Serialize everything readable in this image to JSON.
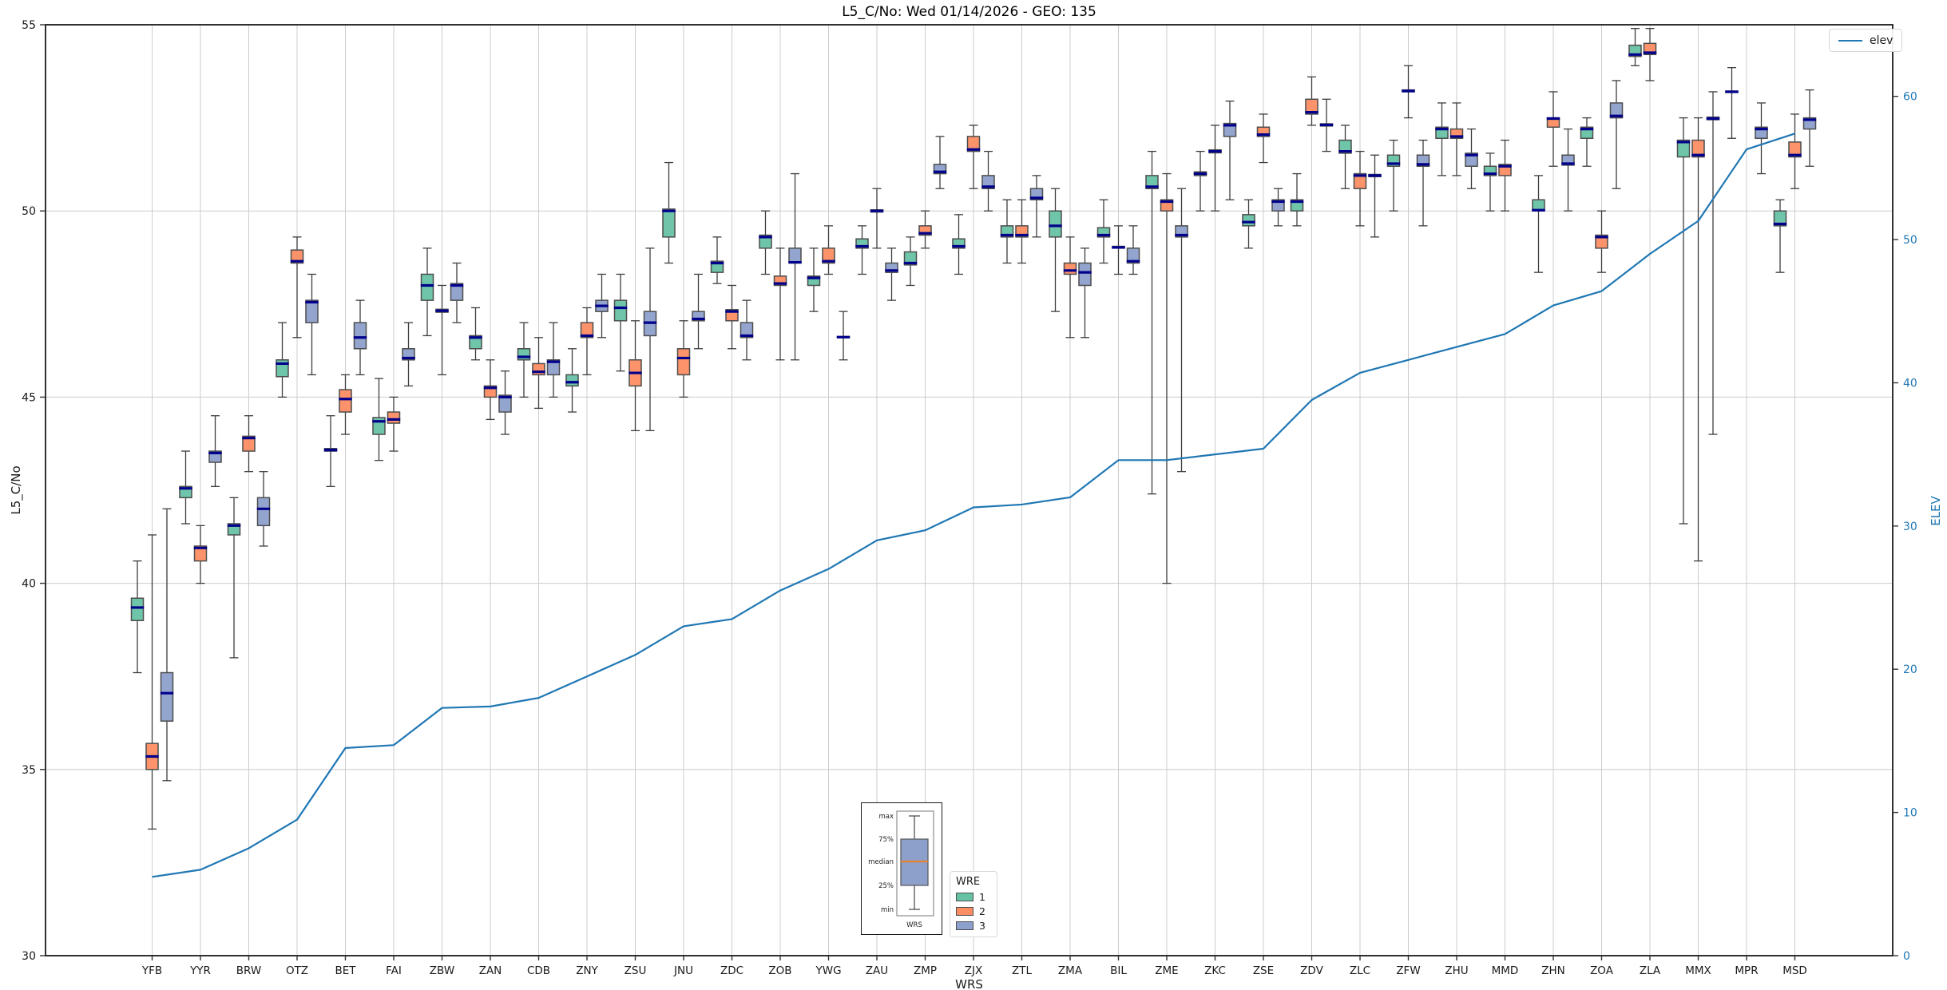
{
  "title": "L5_C/No: Wed 01/14/2026 - GEO: 135",
  "axes": {
    "left": {
      "label": "L5_C/No",
      "ticks": [
        55,
        50,
        45,
        40,
        35,
        30
      ],
      "range": [
        30,
        55
      ]
    },
    "right": {
      "label": "ELEV",
      "ticks": [
        60,
        50,
        40,
        30,
        20,
        10,
        0
      ],
      "range": [
        0,
        65
      ],
      "color": "#1f77b4"
    },
    "x": {
      "label": "WRS"
    }
  },
  "legend_elev": {
    "label": "elev"
  },
  "legend_wre": {
    "title": "WRE",
    "entries": [
      {
        "label": "1",
        "color": "#66c2a5"
      },
      {
        "label": "2",
        "color": "#fc8d62"
      },
      {
        "label": "3",
        "color": "#8da0cb"
      }
    ]
  },
  "inset": {
    "labels": [
      "max",
      "75%",
      "median",
      "25%",
      "min"
    ],
    "xlabel": "WRS",
    "box_color": "#8da0cb",
    "median_color": "#e8822d"
  },
  "style": {
    "grid_color": "#cccccc",
    "spine_color": "#1a1a1a",
    "box_edge_color": "#4d4d4d",
    "median_color": "#00008b",
    "whisker_color": "#3d3d3d",
    "line_color": "#1f77b4"
  },
  "chart_data": {
    "type": "boxplot+line",
    "title": "L5_C/No: Wed 01/14/2026 - GEO: 135",
    "xlabel": "WRS",
    "ylabel_left": "L5_C/No",
    "ylabel_right": "ELEV",
    "ylim_left": [
      30,
      55
    ],
    "ylim_right": [
      0,
      65
    ],
    "grid": true,
    "legend_position": "upper right",
    "categories": [
      "YFB",
      "YYR",
      "BRW",
      "OTZ",
      "BET",
      "FAI",
      "ZBW",
      "ZAN",
      "CDB",
      "ZNY",
      "ZSU",
      "JNU",
      "ZDC",
      "ZOB",
      "YWG",
      "ZAU",
      "ZMP",
      "ZJX",
      "ZTL",
      "ZMA",
      "BIL",
      "ZME",
      "ZKC",
      "ZSE",
      "ZDV",
      "ZLC",
      "ZFW",
      "ZHU",
      "MMD",
      "ZHN",
      "ZOA",
      "ZLA",
      "MMX",
      "MPR",
      "MSD"
    ],
    "box_stats_order": [
      "min",
      "q1",
      "median",
      "q3",
      "max"
    ],
    "series": [
      {
        "name": "1",
        "color": "#66c2a5",
        "boxes": [
          [
            37.6,
            39.0,
            39.35,
            39.6,
            40.6
          ],
          [
            41.6,
            42.3,
            42.55,
            42.6,
            43.55
          ],
          [
            38.0,
            41.3,
            41.55,
            41.6,
            42.3
          ],
          [
            45.0,
            45.55,
            45.9,
            46.0,
            47.0
          ],
          [
            42.6,
            43.55,
            43.58,
            43.62,
            44.5
          ],
          [
            43.3,
            44.0,
            44.35,
            44.45,
            45.5
          ],
          [
            46.65,
            47.6,
            48.0,
            48.3,
            49.0
          ],
          [
            46.0,
            46.3,
            46.6,
            46.65,
            47.4
          ],
          [
            45.0,
            46.0,
            46.08,
            46.3,
            47.0
          ],
          [
            44.6,
            45.3,
            45.4,
            45.6,
            46.3
          ],
          [
            45.7,
            47.05,
            47.4,
            47.6,
            48.3
          ],
          [
            48.6,
            49.3,
            50.0,
            50.05,
            51.3
          ],
          [
            48.05,
            48.35,
            48.6,
            48.65,
            49.3
          ],
          [
            48.3,
            49.0,
            49.3,
            49.35,
            50.0
          ],
          [
            47.3,
            48.0,
            48.2,
            48.25,
            49.0
          ],
          [
            48.3,
            49.0,
            49.05,
            49.25,
            49.6
          ],
          [
            48.0,
            48.55,
            48.6,
            48.9,
            49.3
          ],
          [
            48.3,
            49.0,
            49.05,
            49.25,
            49.9
          ],
          [
            48.6,
            49.3,
            49.35,
            49.6,
            50.3
          ],
          [
            47.3,
            49.3,
            49.6,
            50.0,
            50.6
          ],
          [
            48.6,
            49.3,
            49.35,
            49.55,
            50.3
          ],
          [
            42.4,
            50.6,
            50.65,
            50.95,
            51.6
          ],
          [
            50.0,
            50.95,
            51.0,
            51.05,
            51.6
          ],
          [
            49.0,
            49.6,
            49.7,
            49.9,
            50.3
          ],
          [
            49.6,
            50.0,
            50.25,
            50.3,
            51.0
          ],
          [
            50.6,
            51.55,
            51.6,
            51.9,
            52.3
          ],
          [
            50.0,
            51.2,
            51.27,
            51.5,
            51.9
          ],
          [
            50.95,
            51.95,
            52.2,
            52.25,
            52.9
          ],
          [
            50.0,
            50.95,
            51.0,
            51.2,
            51.55
          ],
          [
            48.35,
            50.0,
            50.02,
            50.3,
            50.95
          ],
          [
            51.2,
            51.95,
            52.2,
            52.25,
            52.5
          ],
          [
            53.9,
            54.15,
            54.2,
            54.45,
            54.9
          ],
          [
            41.6,
            51.45,
            51.85,
            51.9,
            52.5
          ],
          [
            51.95,
            53.18,
            53.2,
            53.22,
            53.85
          ],
          [
            48.35,
            49.6,
            49.65,
            50.0,
            50.3
          ]
        ]
      },
      {
        "name": "2",
        "color": "#fc8d62",
        "boxes": [
          [
            33.4,
            35.0,
            35.35,
            35.7,
            41.3
          ],
          [
            40.0,
            40.6,
            40.95,
            41.0,
            41.55
          ],
          [
            43.0,
            43.55,
            43.9,
            43.95,
            44.5
          ],
          [
            46.6,
            48.6,
            48.65,
            48.95,
            49.3
          ],
          [
            44.0,
            44.6,
            44.95,
            45.2,
            45.6
          ],
          [
            43.55,
            44.3,
            44.4,
            44.6,
            45.0
          ],
          [
            45.6,
            47.28,
            47.32,
            47.36,
            48.0
          ],
          [
            44.4,
            45.0,
            45.25,
            45.3,
            46.0
          ],
          [
            44.7,
            45.6,
            45.68,
            45.9,
            46.6
          ],
          [
            45.6,
            46.6,
            46.65,
            47.0,
            47.4
          ],
          [
            44.1,
            45.3,
            45.65,
            46.0,
            47.05
          ],
          [
            45.0,
            45.6,
            46.05,
            46.3,
            47.05
          ],
          [
            46.3,
            47.05,
            47.3,
            47.35,
            48.0
          ],
          [
            46.0,
            48.0,
            48.05,
            48.25,
            49.0
          ],
          [
            48.3,
            48.6,
            48.65,
            49.0,
            49.6
          ],
          [
            49.0,
            49.97,
            50.0,
            50.03,
            50.6
          ],
          [
            49.0,
            49.35,
            49.4,
            49.6,
            50.0
          ],
          [
            50.6,
            51.6,
            51.65,
            52.0,
            52.3
          ],
          [
            48.6,
            49.3,
            49.35,
            49.6,
            50.3
          ],
          [
            46.6,
            48.3,
            48.4,
            48.6,
            49.3
          ],
          [
            48.3,
            49.0,
            49.02,
            49.05,
            49.6
          ],
          [
            40.0,
            50.0,
            50.25,
            50.3,
            51.0
          ],
          [
            50.0,
            51.56,
            51.6,
            51.64,
            52.3
          ],
          [
            51.3,
            52.0,
            52.05,
            52.25,
            52.6
          ],
          [
            52.3,
            52.6,
            52.65,
            53.0,
            53.6
          ],
          [
            49.6,
            50.6,
            50.95,
            51.0,
            51.6
          ],
          [
            52.5,
            53.2,
            53.22,
            53.25,
            53.9
          ],
          [
            50.95,
            51.95,
            52.0,
            52.2,
            52.9
          ],
          [
            50.0,
            50.95,
            51.2,
            51.25,
            51.9
          ],
          [
            51.2,
            52.25,
            52.48,
            52.5,
            53.2
          ],
          [
            48.35,
            49.0,
            49.3,
            49.35,
            50.0
          ],
          [
            53.5,
            54.2,
            54.25,
            54.5,
            54.9
          ],
          [
            40.6,
            51.45,
            51.5,
            51.9,
            52.5
          ],
          null,
          [
            50.6,
            51.45,
            51.5,
            51.85,
            52.6
          ]
        ]
      },
      {
        "name": "3",
        "color": "#8da0cb",
        "boxes": [
          [
            34.7,
            36.3,
            37.05,
            37.6,
            42.0
          ],
          [
            42.6,
            43.25,
            43.5,
            43.55,
            44.5
          ],
          [
            41.0,
            41.55,
            42.0,
            42.3,
            43.0
          ],
          [
            45.6,
            47.0,
            47.55,
            47.6,
            48.3
          ],
          [
            45.6,
            46.3,
            46.6,
            47.0,
            47.6
          ],
          [
            45.3,
            46.0,
            46.05,
            46.3,
            47.0
          ],
          [
            47.0,
            47.6,
            48.0,
            48.05,
            48.6
          ],
          [
            44.0,
            44.6,
            45.0,
            45.05,
            45.7
          ],
          [
            45.0,
            45.6,
            45.95,
            46.0,
            47.0
          ],
          [
            46.6,
            47.3,
            47.45,
            47.6,
            48.3
          ],
          [
            44.1,
            46.65,
            47.0,
            47.3,
            49.0
          ],
          [
            46.3,
            47.05,
            47.1,
            47.3,
            48.3
          ],
          [
            46.0,
            46.6,
            46.65,
            47.0,
            47.6
          ],
          [
            46.0,
            48.6,
            48.62,
            49.0,
            51.0
          ],
          [
            46.0,
            46.6,
            46.61,
            46.63,
            47.3
          ],
          [
            47.6,
            48.35,
            48.4,
            48.6,
            49.0
          ],
          [
            50.6,
            51.0,
            51.05,
            51.25,
            52.0
          ],
          [
            50.0,
            50.6,
            50.65,
            50.95,
            51.6
          ],
          [
            49.3,
            50.3,
            50.35,
            50.6,
            50.95
          ],
          [
            46.6,
            48.0,
            48.35,
            48.6,
            49.0
          ],
          [
            48.3,
            48.6,
            48.65,
            49.0,
            49.6
          ],
          [
            43.0,
            49.3,
            49.35,
            49.6,
            50.6
          ],
          [
            50.3,
            52.0,
            52.3,
            52.35,
            52.95
          ],
          [
            49.6,
            50.0,
            50.25,
            50.3,
            50.6
          ],
          [
            51.6,
            52.28,
            52.31,
            52.34,
            53.0
          ],
          [
            49.3,
            50.92,
            50.95,
            50.98,
            51.5
          ],
          [
            49.6,
            51.2,
            51.25,
            51.5,
            51.9
          ],
          [
            50.6,
            51.2,
            51.5,
            51.55,
            52.2
          ],
          null,
          [
            50.0,
            51.23,
            51.27,
            51.5,
            52.2
          ],
          [
            50.6,
            52.5,
            52.55,
            52.9,
            53.5
          ],
          null,
          [
            44.0,
            52.45,
            52.48,
            52.52,
            53.2
          ],
          [
            51.0,
            51.95,
            52.2,
            52.25,
            52.9
          ],
          [
            51.2,
            52.2,
            52.45,
            52.5,
            53.25
          ]
        ]
      }
    ],
    "line": {
      "name": "elev",
      "color": "#1f77b4",
      "axis": "right",
      "values": [
        5.5,
        6.0,
        7.5,
        9.5,
        14.5,
        14.7,
        17.3,
        17.4,
        18.0,
        19.5,
        21.0,
        23.0,
        23.5,
        25.5,
        27.0,
        29.0,
        29.7,
        31.3,
        31.5,
        32.0,
        34.6,
        34.6,
        35.0,
        35.4,
        38.8,
        40.7,
        41.6,
        42.5,
        43.4,
        45.4,
        46.4,
        49.0,
        51.3,
        56.3,
        57.4
      ]
    }
  }
}
